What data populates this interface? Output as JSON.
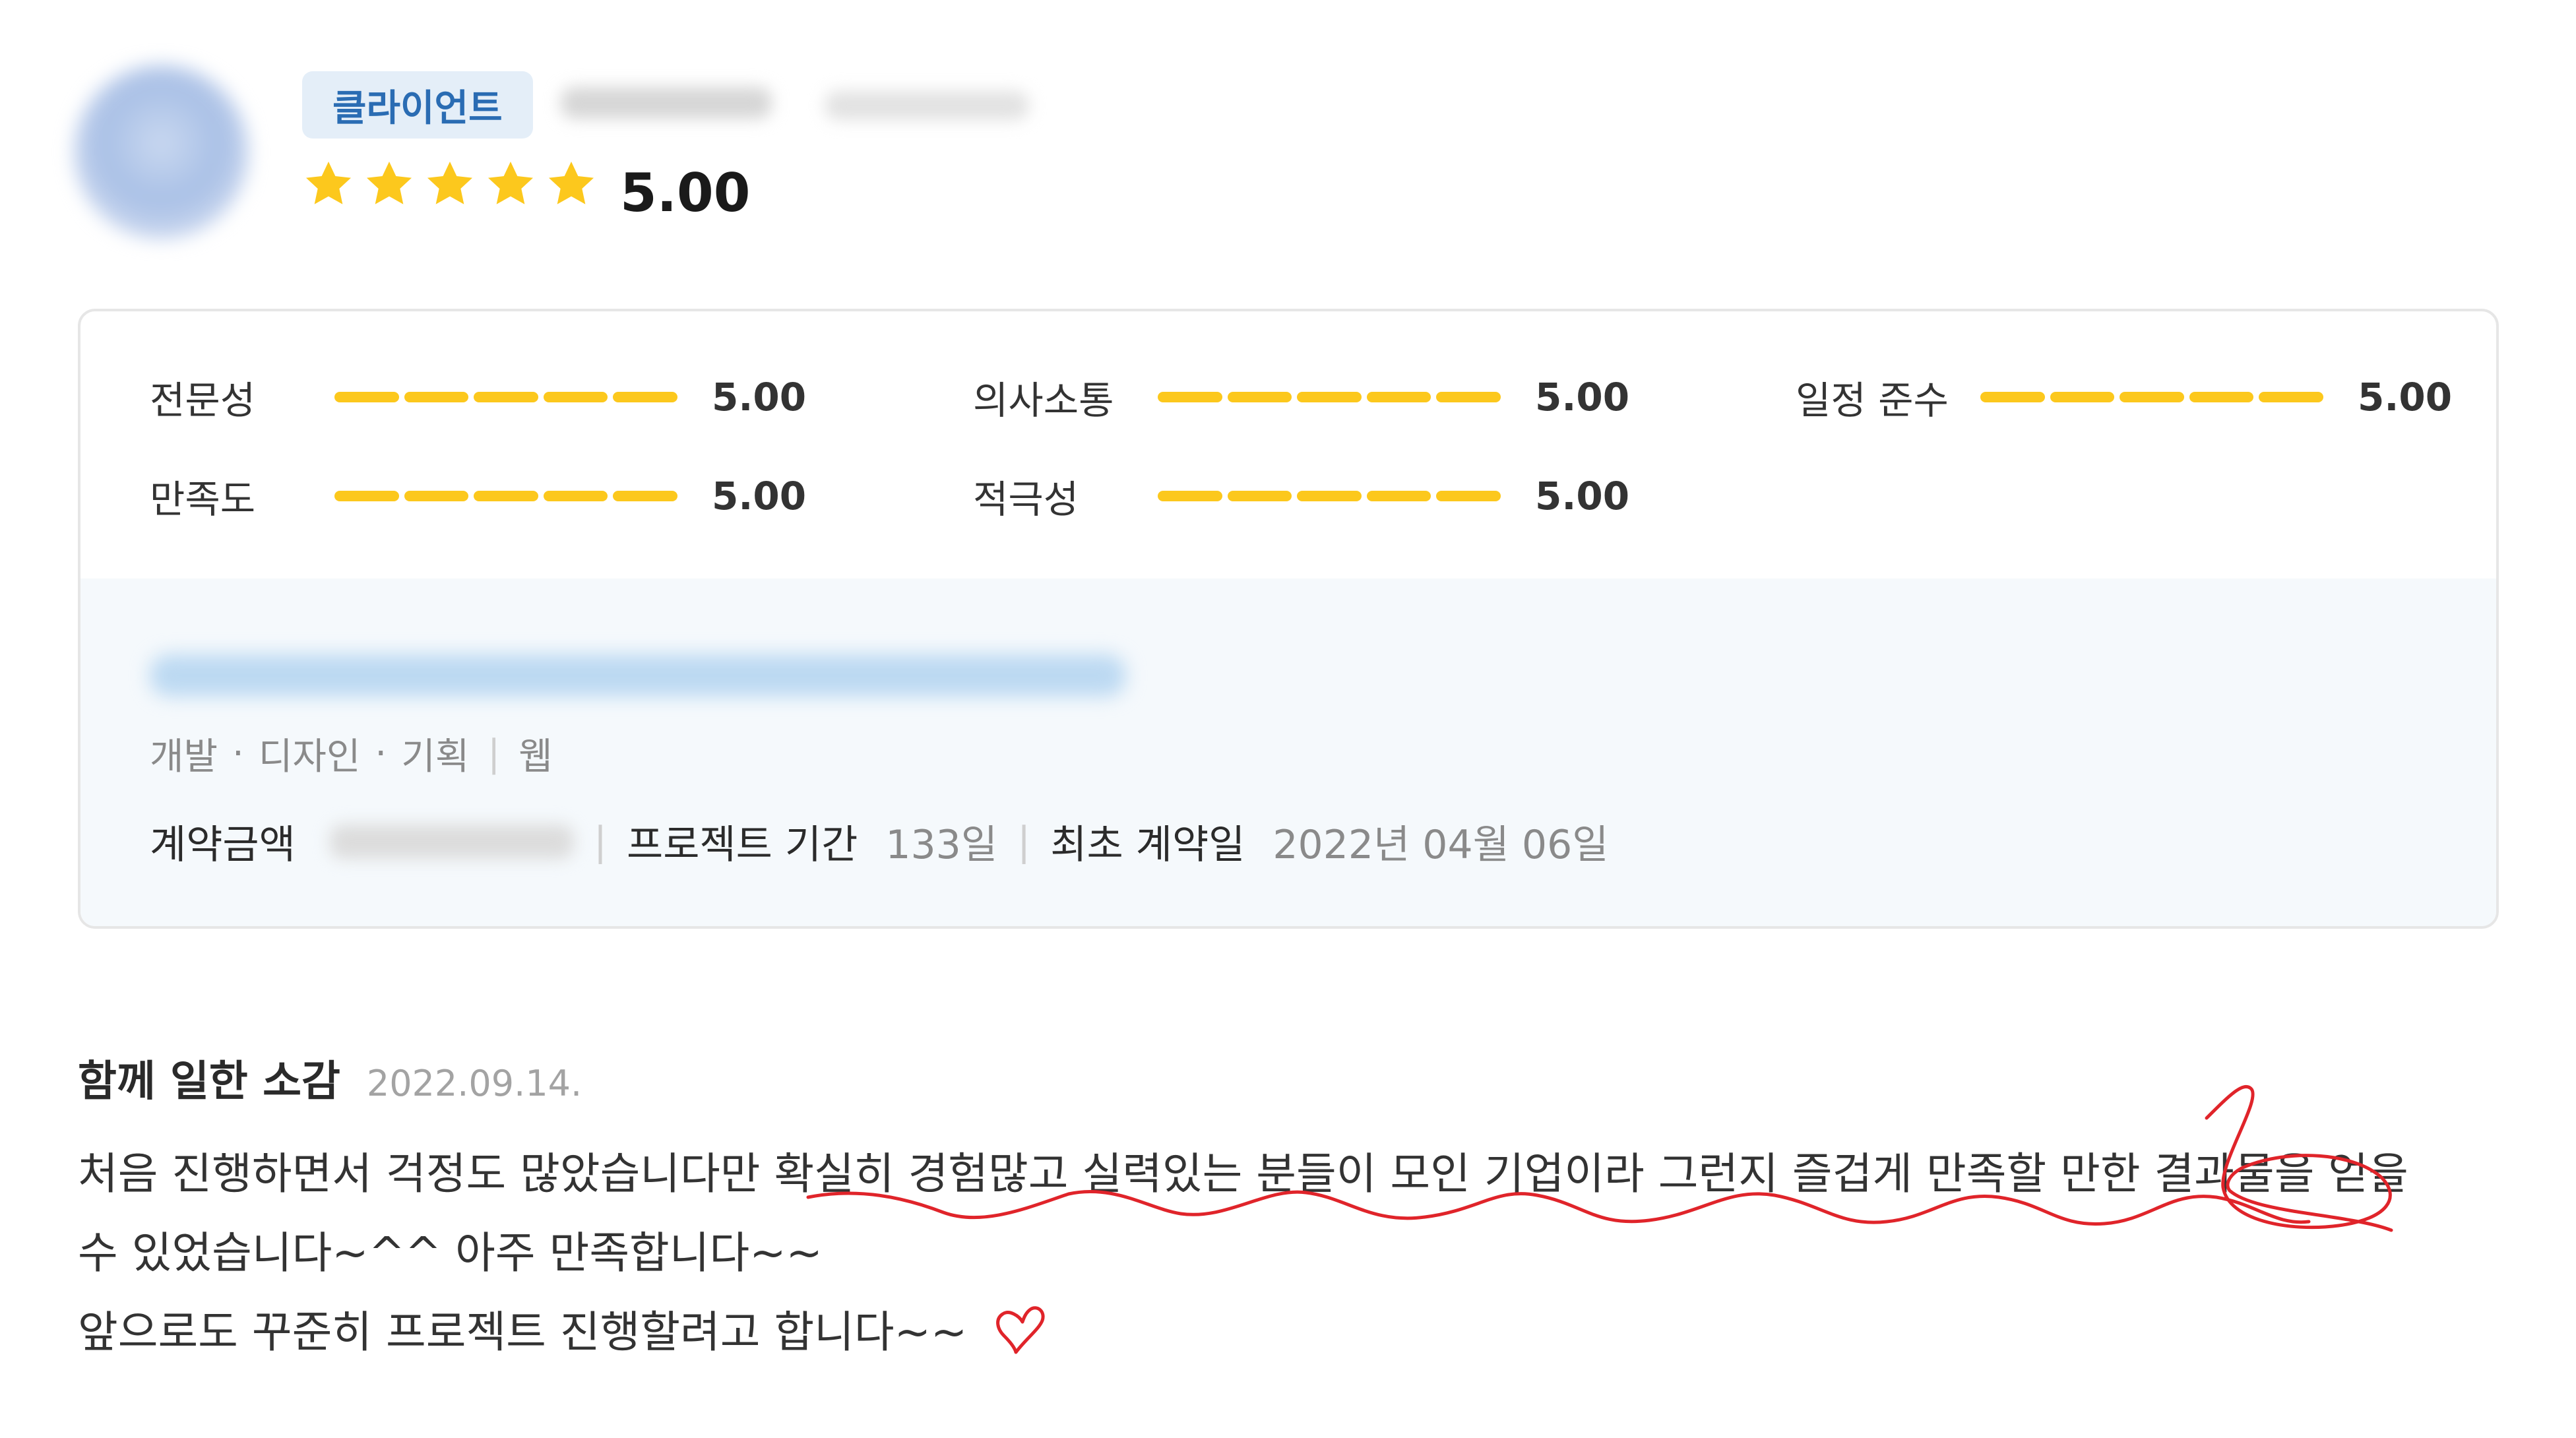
{
  "header": {
    "badge_label": "클라이언트",
    "rating": "5.00",
    "stars_filled": 5,
    "stars_total": 5
  },
  "ratings": [
    {
      "label": "전문성",
      "score": "5.00",
      "fill": 1.0
    },
    {
      "label": "의사소통",
      "score": "5.00",
      "fill": 1.0
    },
    {
      "label": "일정 준수",
      "score": "5.00",
      "fill": 1.0
    },
    {
      "label": "만족도",
      "score": "5.00",
      "fill": 1.0
    },
    {
      "label": "적극성",
      "score": "5.00",
      "fill": 1.0
    }
  ],
  "project": {
    "categories": [
      "개발",
      "디자인",
      "기획"
    ],
    "category_dot": "·",
    "platform": "웹",
    "contract_amount_label": "계약금액",
    "duration_label": "프로젝트 기간",
    "duration_value": "133일",
    "first_contract_label": "최초 계약일",
    "first_contract_value": "2022년 04월 06일"
  },
  "review": {
    "title": "함께 일한 소감",
    "date": "2022.09.14.",
    "line1": "처음 진행하면서 걱정도 많았습니다만 확실히 경험많고 실력있는 분들이 모인 기업이라 그런지 즐겁게 만족할 만한 결과물을 얻을",
    "line2": "수 있었습니다~^^ 아주 만족합니다~~",
    "line3": "앞으로도 꾸준히 프로젝트 진행할려고 합니다~~"
  },
  "colors": {
    "star": "#fcc81d",
    "bar": "#fcc81d",
    "badge_bg": "#e4eef8",
    "badge_text": "#2a6cb3",
    "annotation": "#e0242a",
    "project_bg": "#f5f9fc"
  }
}
